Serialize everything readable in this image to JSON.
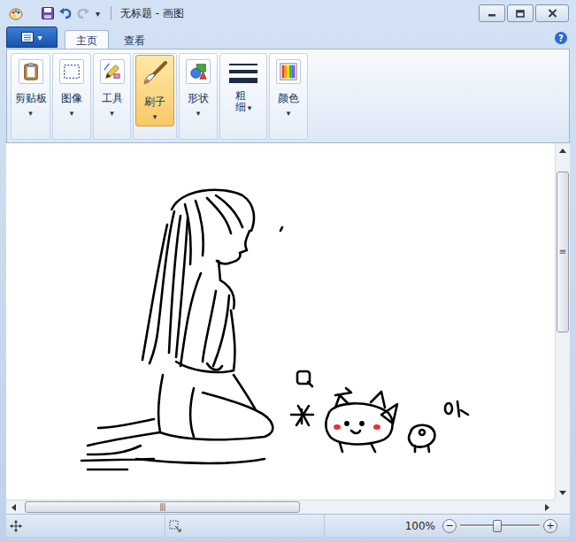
{
  "window": {
    "title": "无标题 - 画图",
    "quick_access_arrow": "▾"
  },
  "app_menu": {
    "arrow": "▾"
  },
  "tabs": [
    {
      "label": "主页",
      "selected": true
    },
    {
      "label": "查看",
      "selected": false
    }
  ],
  "help": "?",
  "ribbon": {
    "groups": [
      {
        "label": "剪贴板",
        "kind": "clipboard",
        "selected": false,
        "arrow": "▾"
      },
      {
        "label": "图像",
        "kind": "image",
        "selected": false,
        "arrow": "▾"
      },
      {
        "label": "工具",
        "kind": "tools",
        "selected": false,
        "arrow": "▾"
      },
      {
        "label": "刷子",
        "kind": "brush",
        "selected": true,
        "arrow": "▾"
      },
      {
        "label": "形状",
        "kind": "shapes",
        "selected": false,
        "arrow": "▾"
      },
      {
        "label": "粗细",
        "kind": "size",
        "selected": false,
        "arrow": "▾"
      },
      {
        "label": "颜色",
        "kind": "colors",
        "selected": false,
        "arrow": "▾"
      }
    ]
  },
  "scrollbars": {
    "vertical": {
      "offset": 0.043,
      "extent": 0.49,
      "grip": "≡"
    },
    "horizontal": {
      "offset": 0.007,
      "extent": 0.53,
      "grip": "|||"
    }
  },
  "status_bar": {
    "zoom": "100%",
    "zoom_out": "−",
    "zoom_in": "+",
    "zoom_level": 0.47
  }
}
